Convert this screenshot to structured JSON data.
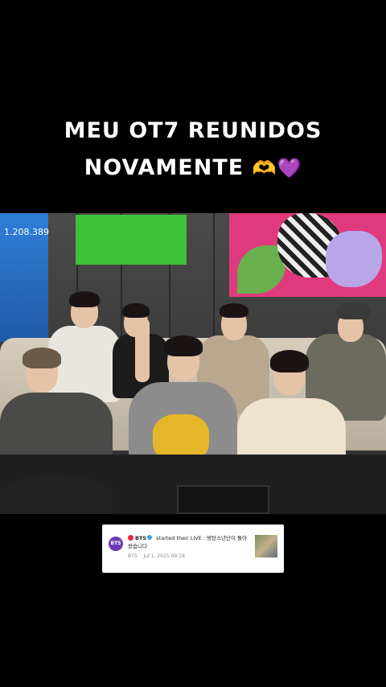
{
  "caption": {
    "line1": "MEU OT7 REUNIDOS",
    "line2": "NOVAMENTE",
    "emojis": "🫶💜"
  },
  "video": {
    "counter": "1.208.389"
  },
  "notification": {
    "avatar_text": "BTS",
    "channel": "BTS",
    "message": "started their LIVE : 방탄소년단이 돌아왔습니다",
    "sub_channel": "BTS",
    "date": "Jul 1, 2025 09:19",
    "live_color": "#e8213a",
    "verified_color": "#39a3e8"
  },
  "icons": [
    "live-dot-icon",
    "verified-badge-icon"
  ]
}
